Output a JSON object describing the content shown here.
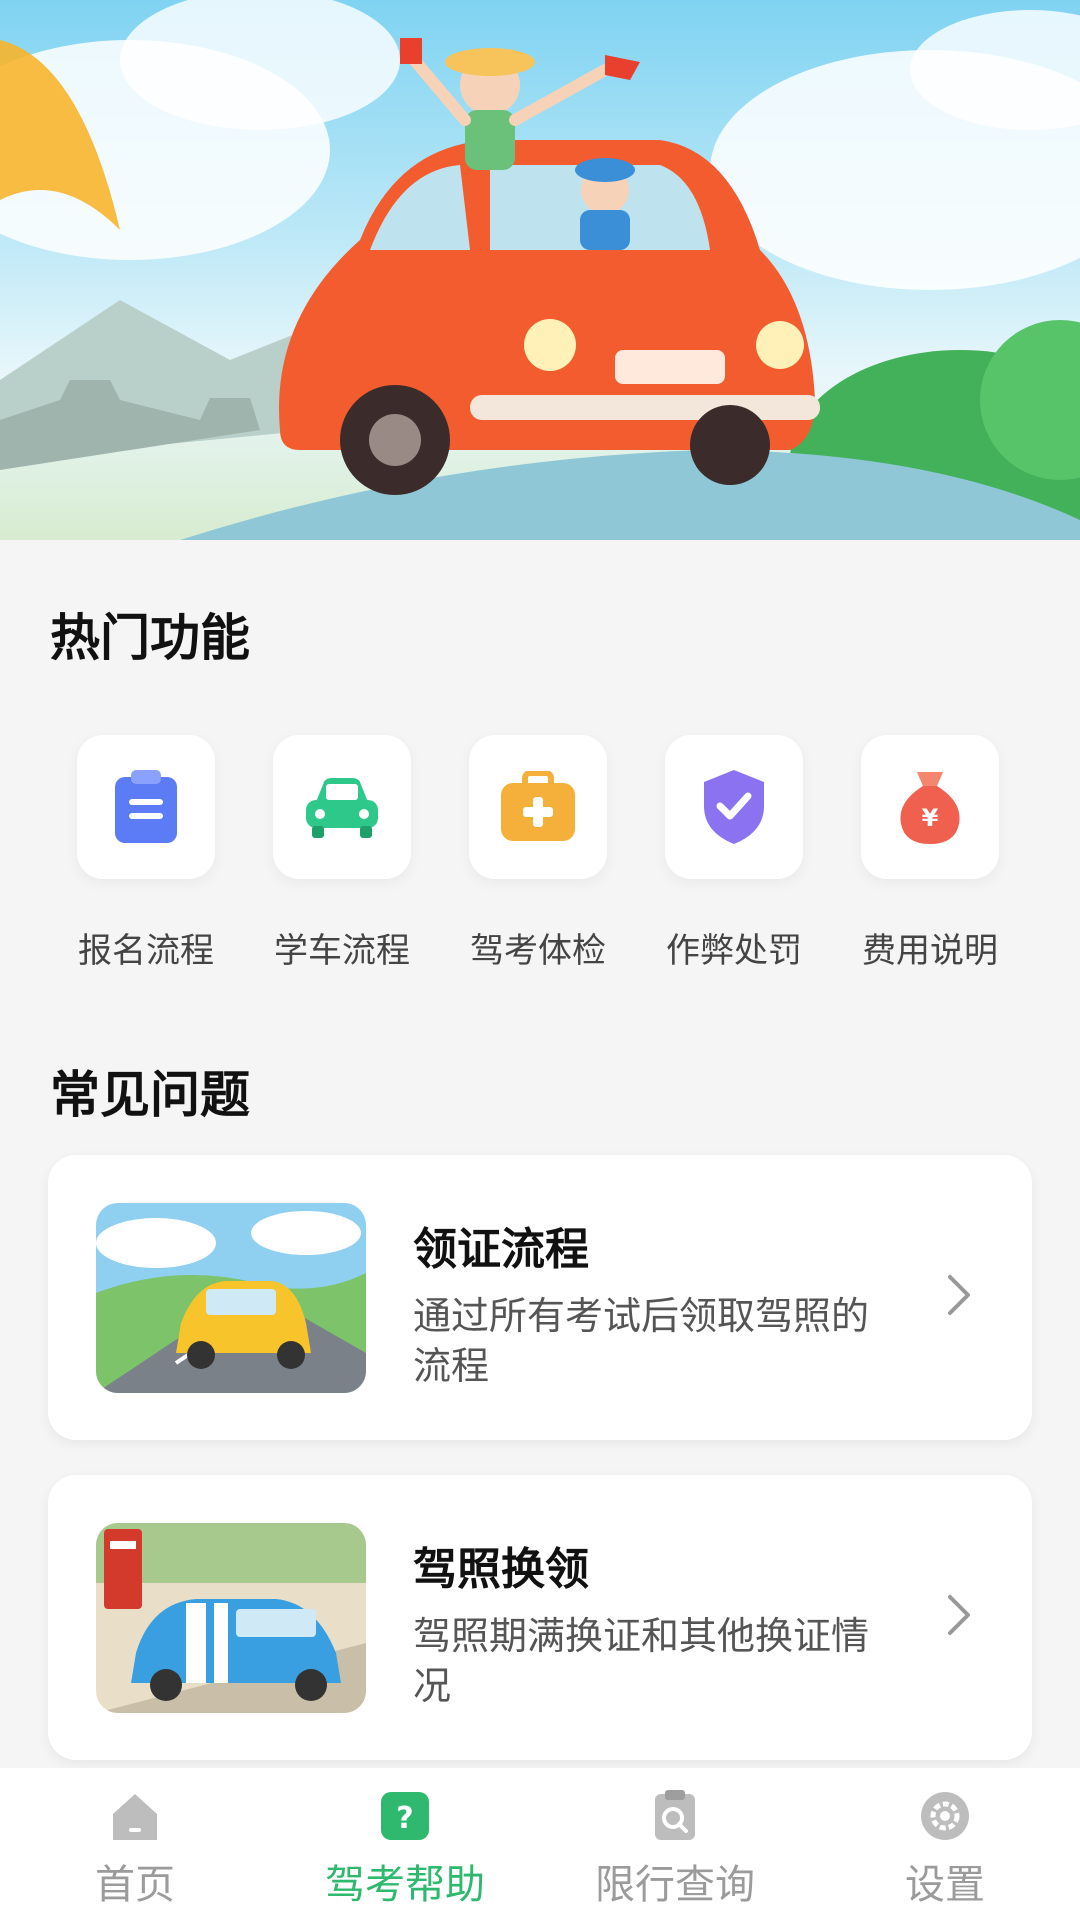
{
  "hot_features": {
    "title": "热门功能",
    "items": [
      {
        "label": "报名流程",
        "icon": "clipboard-icon",
        "color": "#5b7cf5"
      },
      {
        "label": "学车流程",
        "icon": "car-icon",
        "color": "#2ec98a"
      },
      {
        "label": "驾考体检",
        "icon": "medical-kit-icon",
        "color": "#f5b03c"
      },
      {
        "label": "作弊处罚",
        "icon": "shield-check-icon",
        "color": "#8a72f0"
      },
      {
        "label": "费用说明",
        "icon": "money-bag-icon",
        "color": "#f0604f"
      }
    ]
  },
  "faq": {
    "title": "常见问题",
    "items": [
      {
        "title": "领证流程",
        "desc": "通过所有考试后领取驾照的流程",
        "thumb": "yellow-car-illustration"
      },
      {
        "title": "驾照换领",
        "desc": "驾照期满换证和其他换证情况",
        "thumb": "blue-car-illustration"
      }
    ]
  },
  "bottom_nav": {
    "items": [
      {
        "label": "首页",
        "icon": "home-icon"
      },
      {
        "label": "驾考帮助",
        "icon": "help-icon"
      },
      {
        "label": "限行查询",
        "icon": "search-clipboard-icon"
      },
      {
        "label": "设置",
        "icon": "gear-icon"
      }
    ],
    "active_color": "#2fb96f",
    "inactive_color": "#9b9b9b"
  }
}
